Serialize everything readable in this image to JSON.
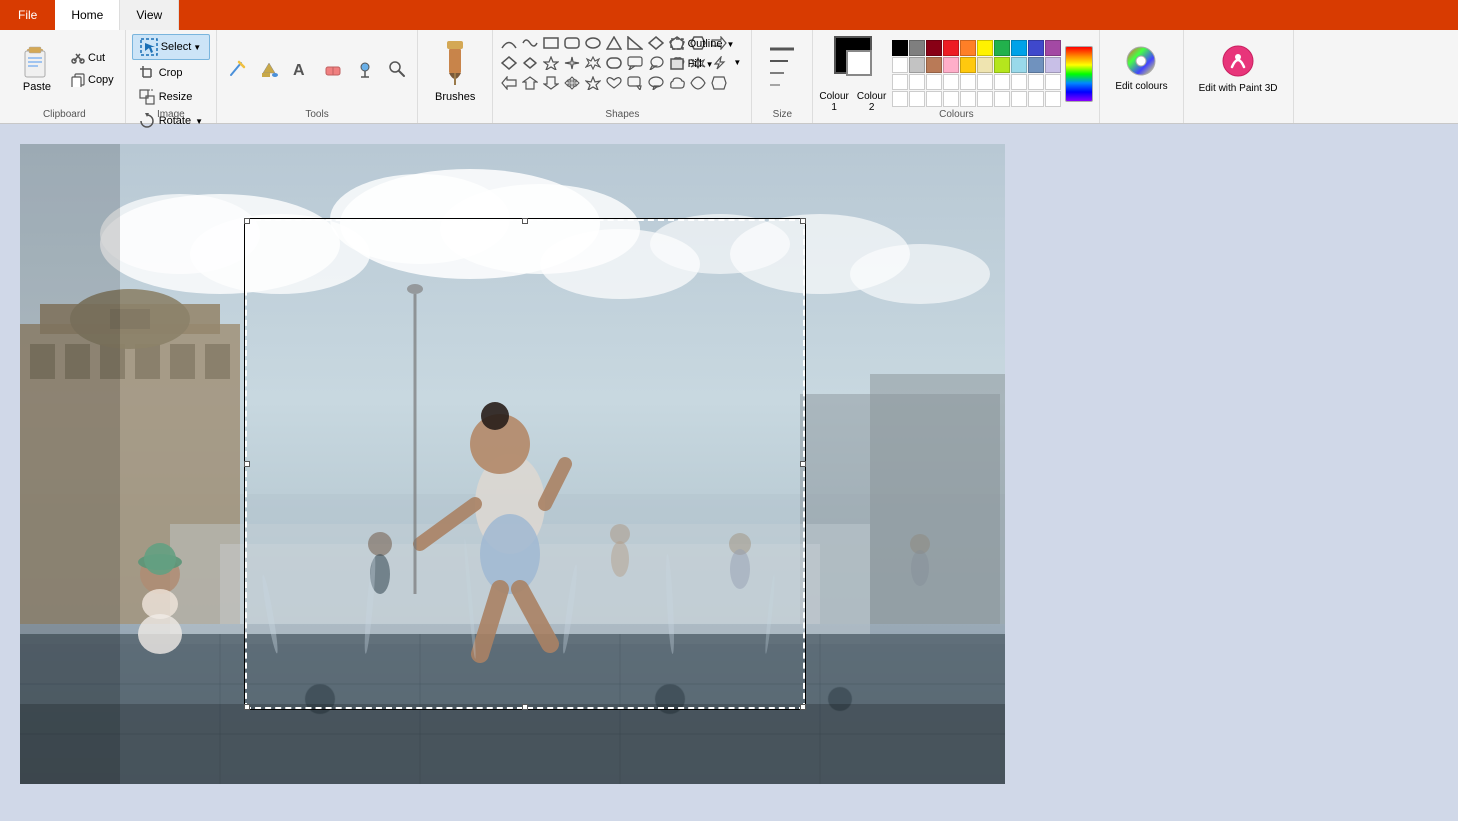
{
  "tabs": {
    "file": "File",
    "home": "Home",
    "view": "View"
  },
  "clipboard": {
    "label": "Clipboard",
    "paste": "Paste",
    "cut": "Cut",
    "copy": "Copy"
  },
  "image": {
    "label": "Image",
    "crop": "Crop",
    "resize": "Resize",
    "rotate": "Rotate"
  },
  "tools": {
    "label": "Tools"
  },
  "brushes": {
    "label": "Brushes"
  },
  "shapes": {
    "label": "Shapes",
    "outline": "Outline",
    "fill": "Fill"
  },
  "size": {
    "label": "Size",
    "size_text": "Size"
  },
  "colours": {
    "label": "Colours",
    "colour1": "Colour",
    "colour1_sub": "1",
    "colour2": "Colour",
    "colour2_sub": "2",
    "edit_colours": "Edit colours",
    "edit_paint3d": "Edit with Paint 3D"
  },
  "palette": {
    "row1": [
      "#000000",
      "#7f7f7f",
      "#880015",
      "#ed1c24",
      "#ff7f27",
      "#fff200",
      "#22b14c",
      "#00a2e8",
      "#3f48cc",
      "#a349a4"
    ],
    "row2": [
      "#ffffff",
      "#c3c3c3",
      "#b97a57",
      "#ffaec9",
      "#ffc90e",
      "#efe4b0",
      "#b5e61d",
      "#99d9ea",
      "#7092be",
      "#c8bfe7"
    ],
    "row3": [
      "#ffffff",
      "#ffffff",
      "#ffffff",
      "#ffffff",
      "#ffffff",
      "#ffffff",
      "#ffffff",
      "#ffffff",
      "#ffffff",
      "#ffffff"
    ],
    "row4": [
      "#ffffff",
      "#ffffff",
      "#ffffff",
      "#ffffff",
      "#ffffff",
      "#ffffff",
      "#ffffff",
      "#ffffff",
      "#ffffff",
      "#ffffff"
    ]
  },
  "active_colour": "#000000",
  "colour2": "#ffffff"
}
